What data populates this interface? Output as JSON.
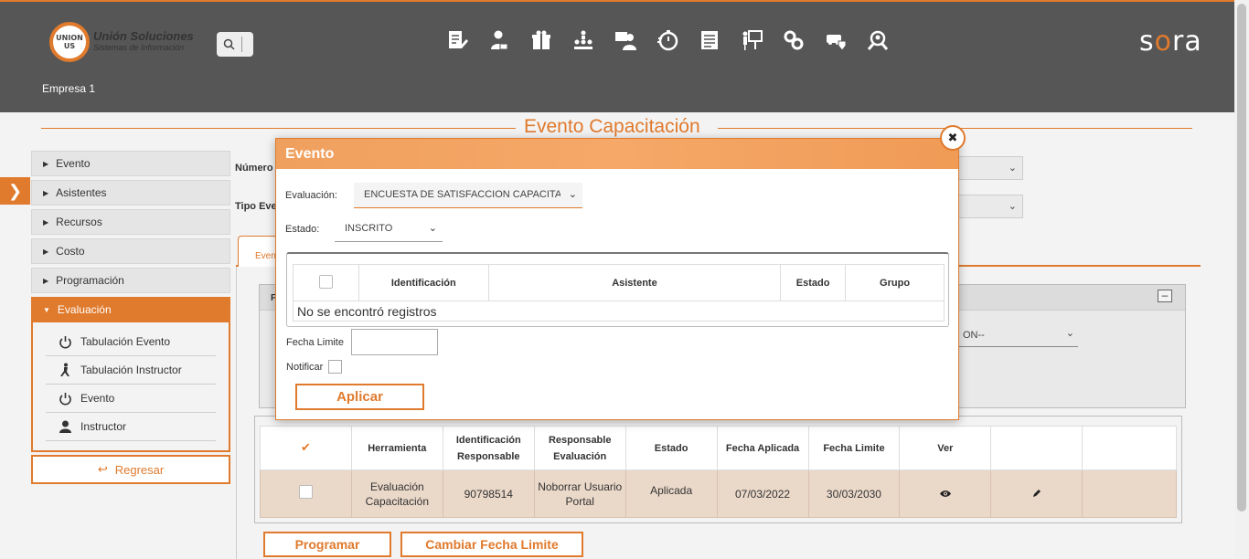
{
  "header": {
    "logo_mark": "UNION US",
    "logo_title": "Unión Soluciones",
    "logo_subtitle": "Sistemas de Información",
    "company": "Empresa 1",
    "brand": "sora",
    "nav_icons": [
      "document-edit-icon",
      "person-id-icon",
      "gift-icon",
      "org-chart-icon",
      "user-board-icon",
      "stopwatch-icon",
      "list-doc-icon",
      "presentation-icon",
      "gears-icon",
      "shield-car-icon",
      "search-person-icon"
    ]
  },
  "page": {
    "title": "Evento Capacitación"
  },
  "sidebar": {
    "items": [
      "Evento",
      "Asistentes",
      "Recursos",
      "Costo",
      "Programación"
    ],
    "active": "Evaluación",
    "subitems": [
      "Tabulación Evento",
      "Tabulación Instructor",
      "Evento",
      "Instructor"
    ],
    "back_label": "Regresar"
  },
  "form_bg": {
    "numero_label": "Número",
    "tipo_label": "Tipo Eve",
    "tab_label": "Even",
    "panel_label": "F",
    "panel_select": "ON--"
  },
  "grid": {
    "headers": [
      "",
      "Herramienta",
      "Identificación Responsable",
      "Responsable Evaluación",
      "Estado",
      "Fecha Aplicada",
      "Fecha Limite",
      "Ver",
      "",
      ""
    ],
    "rows": [
      {
        "herramienta": "Evaluación Capacitación",
        "identificacion": "90798514",
        "responsable": "Noborrar Usuario Portal",
        "estado": "Aplicada",
        "fecha_aplicada": "07/03/2022",
        "fecha_limite": "30/03/2030"
      }
    ]
  },
  "buttons": {
    "programar": "Programar",
    "cambiar_fecha": "Cambiar Fecha Limite"
  },
  "modal": {
    "title": "Evento",
    "evaluacion_label": "Evaluación:",
    "evaluacion_value": "ENCUESTA DE SATISFACCION CAPACITA",
    "estado_label": "Estado:",
    "estado_value": "INSCRITO",
    "table_headers": [
      "",
      "Identificación",
      "Asistente",
      "Estado",
      "Grupo"
    ],
    "empty_message": "No se encontró registros",
    "fecha_limite_label": "Fecha Limite",
    "fecha_limite_value": "",
    "notificar_label": "Notificar",
    "apply_label": "Aplicar"
  },
  "colors": {
    "accent": "#e07a2d",
    "header_bg": "#565656"
  }
}
